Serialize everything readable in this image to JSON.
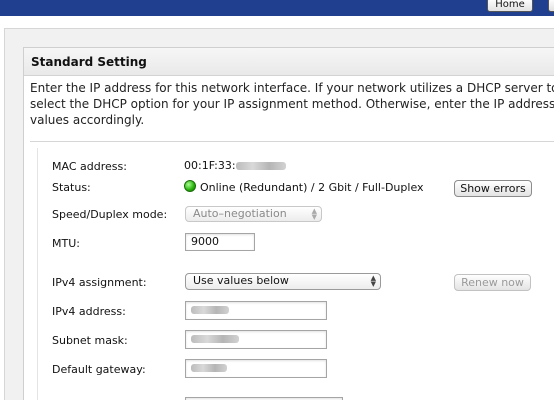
{
  "header": {
    "home_label": "Home"
  },
  "panel": {
    "title": "Standard Setting",
    "intro": "Enter the IP address for this network interface. If your network utilizes a DHCP server to\nselect the DHCP option for your IP assignment method. Otherwise, enter the IP address\nvalues accordingly."
  },
  "fields": {
    "mac_label": "MAC address:",
    "mac_value": "00:1F:33:",
    "status_label": "Status:",
    "status_value": "Online (Redundant) / 2 Gbit / Full-Duplex",
    "show_errors_label": "Show errors",
    "speed_label": "Speed/Duplex mode:",
    "speed_value": "Auto–negotiation",
    "mtu_label": "MTU:",
    "mtu_value": "9000",
    "ipv4_assign_label": "IPv4 assignment:",
    "ipv4_assign_value": "Use values below",
    "renew_label": "Renew now",
    "ipv4_addr_label": "IPv4 address:",
    "subnet_label": "Subnet mask:",
    "gateway_label": "Default gateway:"
  },
  "colors": {
    "topbar": "#20408f",
    "status_online": "#26b00a"
  },
  "icons": {
    "status": "green-status-dot-icon",
    "select_arrows": "updown-arrows-icon"
  }
}
